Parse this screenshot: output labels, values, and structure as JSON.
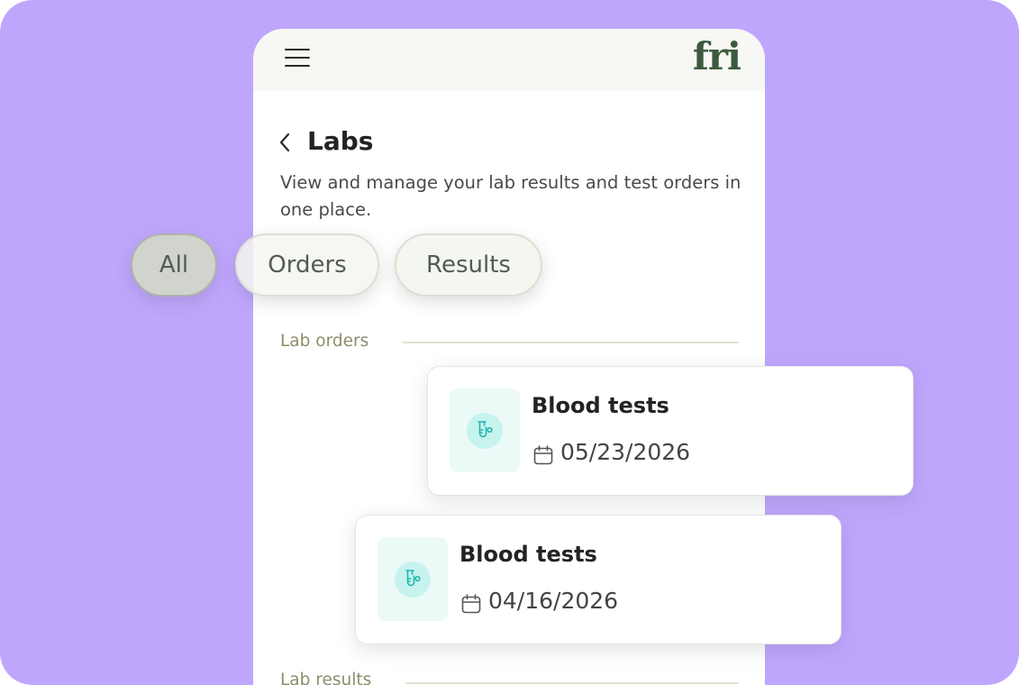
{
  "app": {
    "logo_text": "fri",
    "menu_icon": "hamburger-menu-icon"
  },
  "page": {
    "title": "Labs",
    "back_icon": "chevron-left-icon",
    "subtitle": "View and manage your lab results and test orders in one place."
  },
  "filters": {
    "selected": "All",
    "items": [
      {
        "label": "All"
      },
      {
        "label": "Orders"
      },
      {
        "label": "Results"
      }
    ]
  },
  "sections": {
    "lab_orders_label": "Lab orders",
    "lab_results_label": "Lab results"
  },
  "orders": [
    {
      "title": "Blood tests",
      "date": "05/23/2026",
      "icon": "test-tube-icon",
      "date_icon": "calendar-icon"
    },
    {
      "title": "Blood tests",
      "date": "04/16/2026",
      "icon": "test-tube-icon",
      "date_icon": "calendar-icon"
    }
  ],
  "colors": {
    "background": "#bfa6fd",
    "logo": "#3e5a3e",
    "accent_teal": "#22b6ad",
    "chip_selected": "#d1d3cd",
    "chip_default": "#f4f6f0",
    "section_label": "#8e8d6b"
  }
}
